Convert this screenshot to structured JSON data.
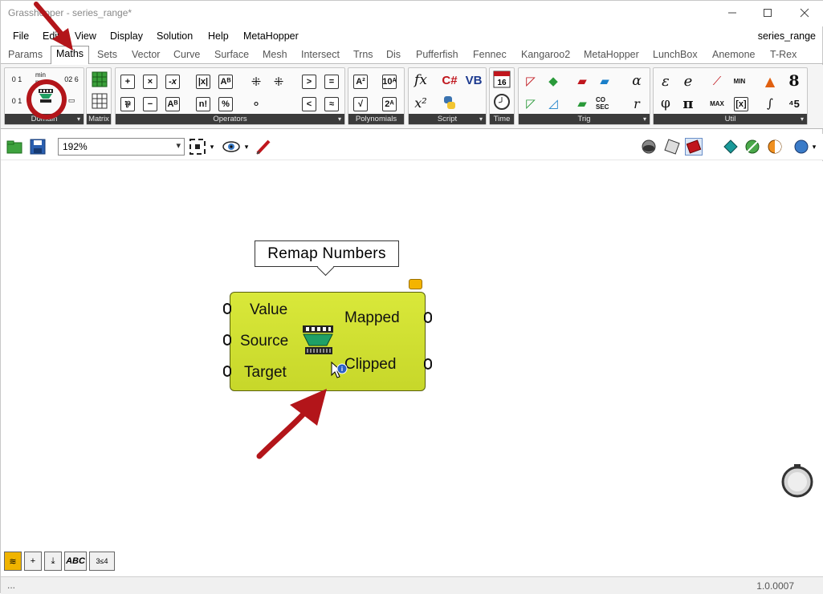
{
  "titlebar": {
    "title": "Grasshopper - series_range*"
  },
  "menu": {
    "items": [
      "File",
      "Edit",
      "View",
      "Display",
      "Solution",
      "Help",
      "MetaHopper"
    ],
    "document_name": "series_range"
  },
  "tabs": {
    "items": [
      "Params",
      "Maths",
      "Sets",
      "Vector",
      "Curve",
      "Surface",
      "Mesh",
      "Intersect",
      "Trns",
      "Dis",
      "Pufferfish",
      "Fennec",
      "Kangaroo2",
      "MetaHopper",
      "LunchBox",
      "Anemone",
      "T-Rex"
    ],
    "active": "Maths"
  },
  "ribbon": {
    "panels": [
      "Domain",
      "Matrix",
      "Operators",
      "Polynomials",
      "Script",
      "Time",
      "Trig",
      "Util"
    ]
  },
  "toolbar": {
    "zoom_value": "192%"
  },
  "canvas": {
    "tooltip": "Remap Numbers",
    "component": {
      "inputs": [
        "Value",
        "Source",
        "Target"
      ],
      "outputs": [
        "Mapped",
        "Clipped"
      ]
    }
  },
  "statusbar": {
    "left_text": "...",
    "version": "1.0.0007"
  },
  "colors": {
    "component_fill": "#cfdd30",
    "annotation_red": "#b3151a",
    "ribbon_label_bg": "#3b3b3b"
  }
}
